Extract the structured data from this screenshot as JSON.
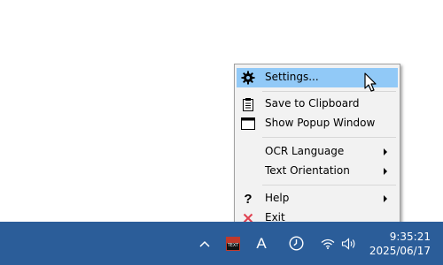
{
  "menu": {
    "items": {
      "settings": {
        "label": "Settings...",
        "icon": "gear-icon"
      },
      "save": {
        "label": "Save to Clipboard",
        "icon": "clipboard-icon"
      },
      "popup": {
        "label": "Show Popup Window",
        "icon": "window-icon"
      },
      "ocr": {
        "label": "OCR Language",
        "icon": null
      },
      "orient": {
        "label": "Text Orientation",
        "icon": null
      },
      "help": {
        "label": "Help",
        "icon": "question-icon"
      },
      "exit": {
        "label": "Exit",
        "icon": "close-icon"
      }
    }
  },
  "taskbar": {
    "tray_icons": [
      "chevron-up-icon",
      "text-capture-app-icon",
      "ime-mode-icon",
      "clock-app-icon",
      "wifi-icon",
      "volume-icon"
    ],
    "app_icon_text": "TEXT",
    "ime_text": "A",
    "time": "9:35:21",
    "date": "2025/06/17"
  },
  "colors": {
    "taskbar": "#2b5d99",
    "highlight": "#91c9f7",
    "exit_icon": "#e04050"
  }
}
